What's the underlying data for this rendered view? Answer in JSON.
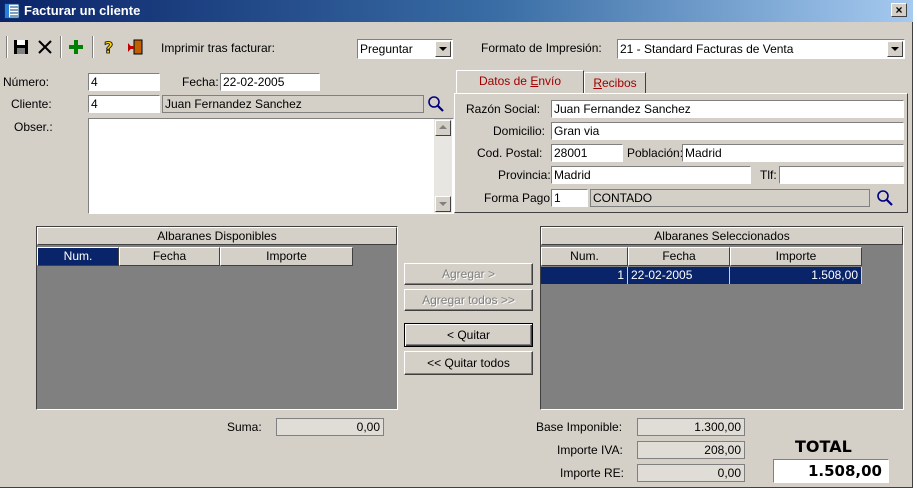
{
  "window": {
    "title": "Facturar un cliente",
    "close_glyph": "×"
  },
  "toolbar": {
    "icons": [
      "save-icon",
      "close-icon",
      "add-icon",
      "help-icon",
      "exit-icon"
    ],
    "print_after_label": "Imprimir tras facturar:",
    "print_after_value": "Preguntar",
    "print_format_label": "Formato de Impresión:",
    "print_format_value": "21 - Standard Facturas de Venta"
  },
  "invoice": {
    "number_label": "Número:",
    "number_value": "4",
    "date_label": "Fecha:",
    "date_value": "22-02-2005",
    "client_label": "Cliente:",
    "client_id": "4",
    "client_name": "Juan Fernandez Sanchez",
    "notes_label": "Obser.:",
    "notes_value": ""
  },
  "tabs": [
    {
      "pre": "Datos de ",
      "accel": "E",
      "post": "nvío",
      "active": true
    },
    {
      "pre": "",
      "accel": "R",
      "post": "ecibos",
      "active": false
    }
  ],
  "shipping": {
    "razon_label": "Razón Social:",
    "razon_value": "Juan Fernandez Sanchez",
    "domicilio_label": "Domicilio:",
    "domicilio_value": "Gran via",
    "cp_label": "Cod. Postal:",
    "cp_value": "28001",
    "poblacion_label": "Población:",
    "poblacion_value": "Madrid",
    "provincia_label": "Provincia:",
    "provincia_value": "Madrid",
    "tlf_label": "Tlf:",
    "tlf_value": "",
    "pago_label": "Forma Pago:",
    "pago_code": "1",
    "pago_name": "CONTADO"
  },
  "available": {
    "title": "Albaranes Disponibles",
    "columns": [
      "Num.",
      "Fecha",
      "Importe"
    ],
    "sum_label": "Suma:",
    "sum_value": "0,00"
  },
  "selected": {
    "title": "Albaranes Seleccionados",
    "columns": [
      "Num.",
      "Fecha",
      "Importe"
    ],
    "rows": [
      {
        "num": "1",
        "fecha": "22-02-2005",
        "importe": "1.508,00"
      }
    ]
  },
  "actions": {
    "add": "Agregar >",
    "add_all": "Agregar todos >>",
    "remove": "< Quitar",
    "remove_all": "<< Quitar todos"
  },
  "totals": {
    "base_label": "Base Imponible:",
    "base_value": "1.300,00",
    "iva_label": "Importe IVA:",
    "iva_value": "208,00",
    "re_label": "Importe RE:",
    "re_value": "0,00",
    "total_label": "TOTAL",
    "total_value": "1.508,00"
  }
}
